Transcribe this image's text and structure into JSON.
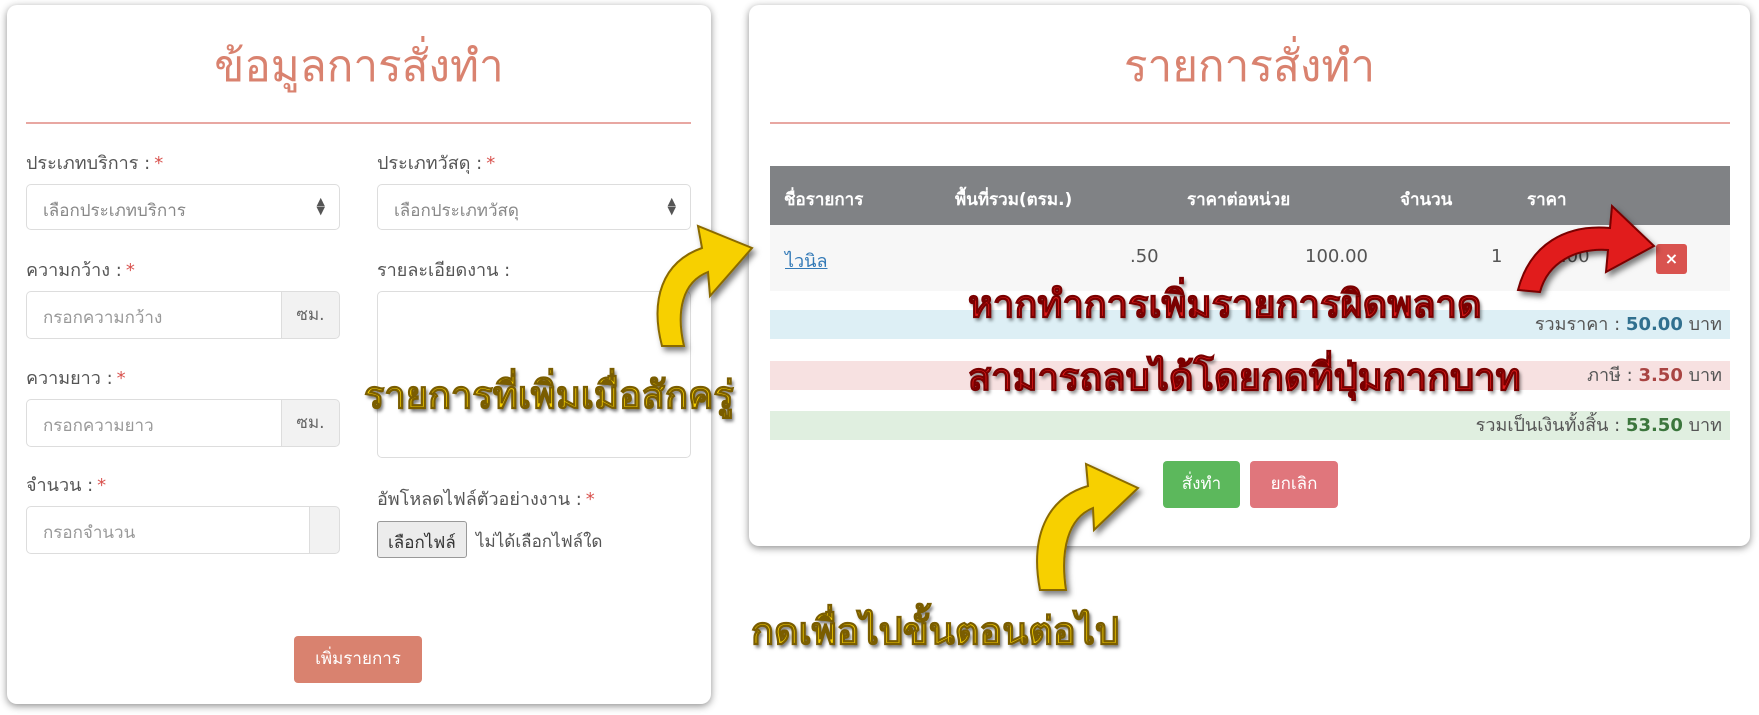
{
  "left_panel": {
    "title": "ข้อมูลการสั่งทำ",
    "fields": {
      "service_type": {
        "label": "ประเภทบริการ :",
        "required": "*",
        "value": "เลือกประเภทบริการ"
      },
      "material_type": {
        "label": "ประเภทวัสดุ :",
        "required": "*",
        "value": "เลือกประเภทวัสดุ"
      },
      "width": {
        "label": "ความกว้าง :",
        "required": "*",
        "placeholder": "กรอกความกว้าง",
        "unit": "ซม."
      },
      "length": {
        "label": "ความยาว :",
        "required": "*",
        "placeholder": "กรอกความยาว",
        "unit": "ซม."
      },
      "quantity": {
        "label": "จำนวน :",
        "required": "*",
        "placeholder": "กรอกจำนวน"
      },
      "details": {
        "label": "รายละเอียดงาน :"
      },
      "upload": {
        "label": "อัพโหลดไฟล์ตัวอย่างงาน :",
        "required": "*",
        "button": "เลือกไฟล์",
        "status": "ไม่ได้เลือกไฟล์ใด"
      }
    },
    "add_button": "เพิ่มรายการ"
  },
  "right_panel": {
    "title": "รายการสั่งทำ",
    "table": {
      "headers": [
        "ชื่อรายการ",
        "พื้นที่รวม(ตรม.)",
        "ราคาต่อหน่วย",
        "จำนวน",
        "ราคา"
      ],
      "rows": [
        {
          "name": "ไวนิล",
          "area": ".50",
          "unit_price": "100.00",
          "qty": "1",
          "price": "50.00",
          "delete": "×"
        }
      ]
    },
    "summary": {
      "total_label": "รวมราคา :",
      "total_value": "50.00",
      "total_unit": "บาท",
      "tax_label": "ภาษี :",
      "tax_value": "3.50",
      "tax_unit": "บาท",
      "grand_label": "รวมเป็นเงินทั้งสิ้น :",
      "grand_value": "53.50",
      "grand_unit": "บาท"
    },
    "order_button": "สั่งทำ",
    "cancel_button": "ยกเลิก"
  },
  "annotations": {
    "added_items": "รายการที่เพิ่มเมื่อสักครู่",
    "delete_hint_line1": "หากทำการเพิ่มรายการผิดพลาด",
    "delete_hint_line2": "สามารถลบได้โดยกดที่ปุ่มกากบาท",
    "next_step": "กดเพื่อไปขั้นตอนต่อไป"
  },
  "colors": {
    "title": "#d9826f",
    "header": "#808285",
    "order": "#5cb85c",
    "cancel": "#e0767c",
    "delete": "#d9534f",
    "annotation_yellow": "#f7d000",
    "annotation_red": "#e11b1b"
  }
}
